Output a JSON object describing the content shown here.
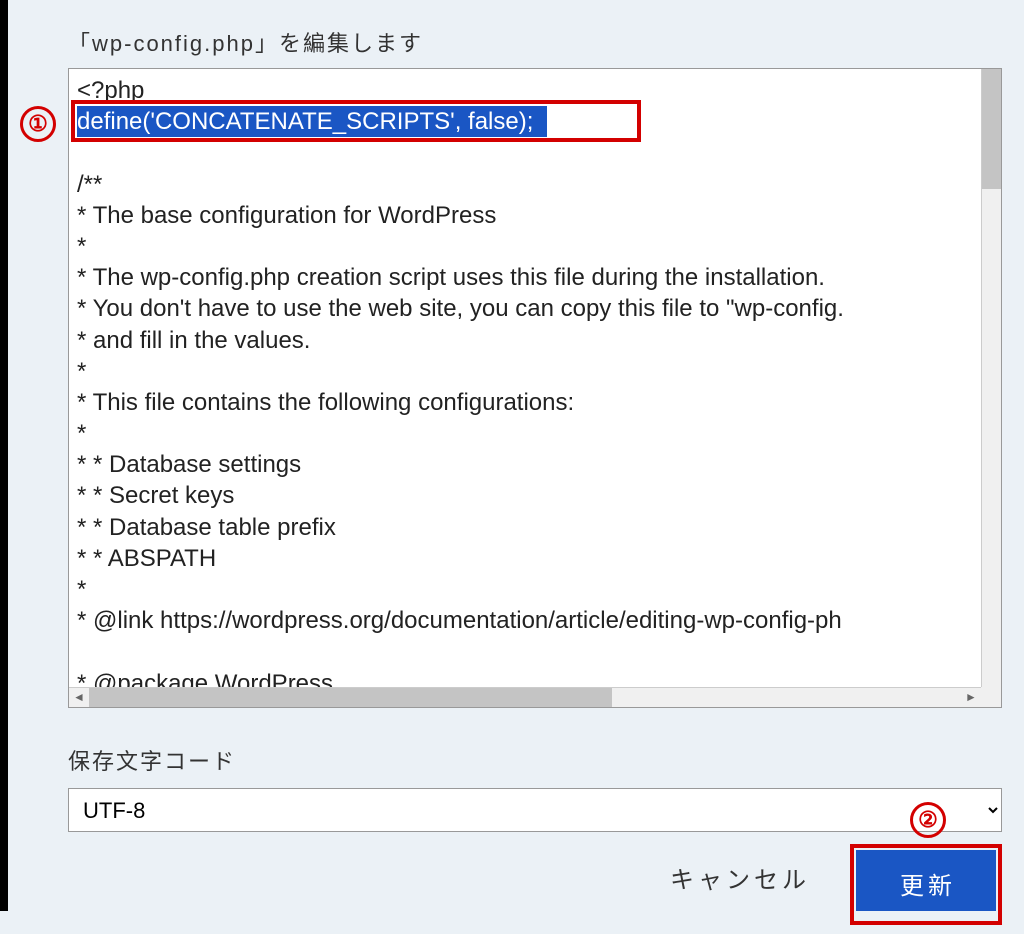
{
  "title": "「wp-config.php」を編集します",
  "annotation1": "①",
  "annotation2": "②",
  "code": {
    "line1": "<?php",
    "selected": "define('CONCATENATE_SCRIPTS', false);",
    "rest": [
      "",
      "/**",
      " * The base configuration for WordPress",
      " *",
      " * The wp-config.php creation script uses this file during the installation.",
      " * You don't have to use the web site, you can copy this file to \"wp-config.",
      " * and fill in the values.",
      " *",
      " * This file contains the following configurations:",
      " *",
      " * * Database settings",
      " * * Secret keys",
      " * * Database table prefix",
      " * * ABSPATH",
      " *",
      " * @link https://wordpress.org/documentation/article/editing-wp-config-ph",
      "",
      " * @package WordPress"
    ]
  },
  "encoding": {
    "label": "保存文字コード",
    "value": "UTF-8"
  },
  "buttons": {
    "cancel": "キャンセル",
    "update": "更新"
  }
}
